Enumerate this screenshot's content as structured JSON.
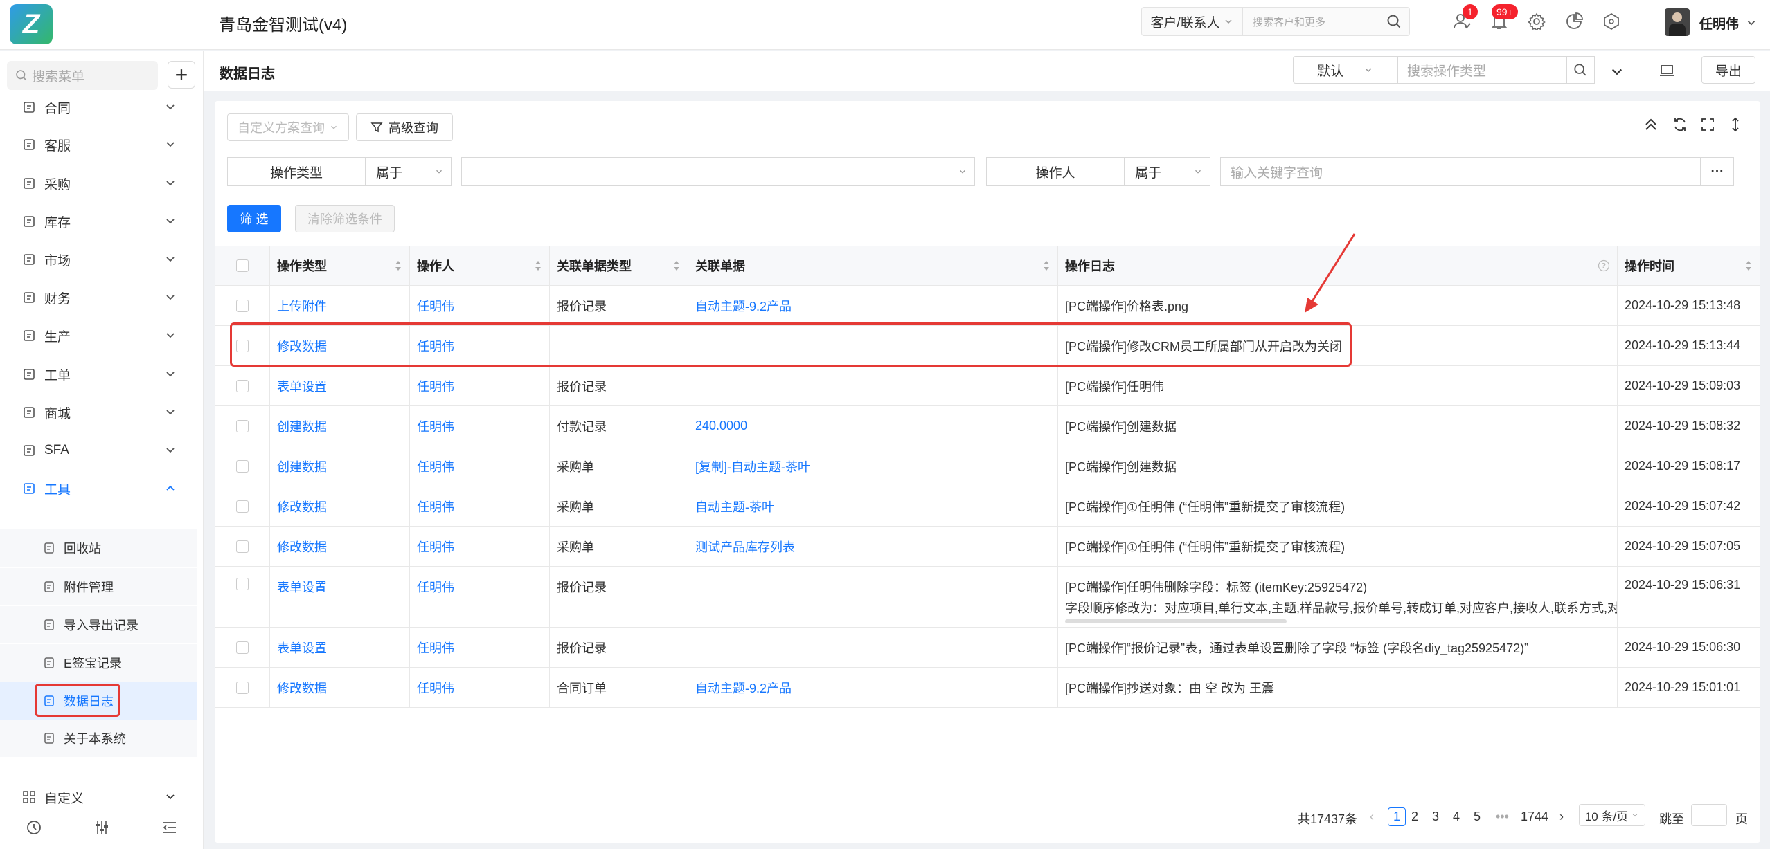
{
  "header": {
    "app_title": "青岛金智测试(v4)",
    "search_scope": "客户/联系人",
    "search_placeholder": "搜索客户和更多",
    "badge_1": "1",
    "badge_2": "99+",
    "user_name": "任明伟"
  },
  "sidebar": {
    "search_placeholder": "搜索菜单",
    "add_label": "+",
    "items": [
      {
        "label": "合同",
        "icon": "contract-icon"
      },
      {
        "label": "客服",
        "icon": "service-icon"
      },
      {
        "label": "采购",
        "icon": "purchase-icon"
      },
      {
        "label": "库存",
        "icon": "warehouse-icon"
      },
      {
        "label": "市场",
        "icon": "market-icon"
      },
      {
        "label": "财务",
        "icon": "finance-icon"
      },
      {
        "label": "生产",
        "icon": "production-icon"
      },
      {
        "label": "工单",
        "icon": "workorder-icon"
      },
      {
        "label": "商城",
        "icon": "mall-icon"
      },
      {
        "label": "SFA",
        "icon": "sfa-icon"
      },
      {
        "label": "工具",
        "icon": "tools-icon"
      }
    ],
    "sub_items": [
      {
        "label": "回收站",
        "icon": "trash-icon"
      },
      {
        "label": "附件管理",
        "icon": "attachment-icon"
      },
      {
        "label": "导入导出记录",
        "icon": "import-export-icon"
      },
      {
        "label": "E签宝记录",
        "icon": "esign-icon"
      },
      {
        "label": "数据日志",
        "icon": "log-icon"
      },
      {
        "label": "关于本系统",
        "icon": "info-icon"
      }
    ],
    "custom_label": "自定义"
  },
  "page": {
    "title": "数据日志",
    "sort_value": "默认",
    "op_type_placeholder": "搜索操作类型",
    "export_label": "导出"
  },
  "toolbar": {
    "scheme_placeholder": "自定义方案查询",
    "advanced_label": "高级查询",
    "filter1_field": "操作类型",
    "filter1_op": "属于",
    "filter2_field": "操作人",
    "filter2_op": "属于",
    "keyword_placeholder": "输入关键字查询",
    "more_label": "···",
    "apply_label": "筛 选",
    "clear_label": "清除筛选条件"
  },
  "table": {
    "columns": [
      "操作类型",
      "操作人",
      "关联单据类型",
      "关联单据",
      "操作日志",
      "操作时间"
    ],
    "rows": [
      {
        "type": "上传附件",
        "user": "任明伟",
        "doc_type": "报价记录",
        "doc": "自动主题-9.2产品",
        "log": "[PC端操作]价格表.png",
        "log2": "",
        "time": "2024-10-29 15:13:48"
      },
      {
        "type": "修改数据",
        "user": "任明伟",
        "doc_type": "",
        "doc": "",
        "log": "[PC端操作]修改CRM员工所属部门从开启改为关闭",
        "log2": "",
        "time": "2024-10-29 15:13:44"
      },
      {
        "type": "表单设置",
        "user": "任明伟",
        "doc_type": "报价记录",
        "doc": "",
        "log": "[PC端操作]任明伟",
        "log2": "",
        "time": "2024-10-29 15:09:03"
      },
      {
        "type": "创建数据",
        "user": "任明伟",
        "doc_type": "付款记录",
        "doc": "240.0000",
        "log": "[PC端操作]创建数据",
        "log2": "",
        "time": "2024-10-29 15:08:32"
      },
      {
        "type": "创建数据",
        "user": "任明伟",
        "doc_type": "采购单",
        "doc": "[复制]-自动主题-茶叶",
        "log": "[PC端操作]创建数据",
        "log2": "",
        "time": "2024-10-29 15:08:17"
      },
      {
        "type": "修改数据",
        "user": "任明伟",
        "doc_type": "采购单",
        "doc": "自动主题-茶叶",
        "log": "[PC端操作]①任明伟 (“任明伟”重新提交了审核流程)",
        "log2": "",
        "time": "2024-10-29 15:07:42"
      },
      {
        "type": "修改数据",
        "user": "任明伟",
        "doc_type": "采购单",
        "doc": "测试产品库存列表",
        "log": "[PC端操作]①任明伟 (“任明伟”重新提交了审核流程)",
        "log2": "",
        "time": "2024-10-29 15:07:05"
      },
      {
        "type": "表单设置",
        "user": "任明伟",
        "doc_type": "报价记录",
        "doc": "",
        "log": "[PC端操作]任明伟删除字段：标签 (itemKey:25925472)",
        "log2": "字段顺序修改为：对应项目,单行文本,主题,样品款号,报价单号,转成订单,对应客户,接收人,联系方式,对应",
        "time": "2024-10-29 15:06:31"
      },
      {
        "type": "表单设置",
        "user": "任明伟",
        "doc_type": "报价记录",
        "doc": "",
        "log": "[PC端操作]“报价记录”表，通过表单设置删除了字段 “标签 (字段名diy_tag25925472)”",
        "log2": "",
        "time": "2024-10-29 15:06:30"
      },
      {
        "type": "修改数据",
        "user": "任明伟",
        "doc_type": "合同订单",
        "doc": "自动主题-9.2产品",
        "log": "[PC端操作]抄送对象：由 空 改为 王震",
        "log2": "",
        "time": "2024-10-29 15:01:01"
      }
    ]
  },
  "pagination": {
    "total": "共17437条",
    "pages": [
      "1",
      "2",
      "3",
      "4",
      "5"
    ],
    "ellipsis": "•••",
    "last": "1744",
    "page_size": "10 条/页",
    "jump_label": "跳至",
    "page_suffix": "页"
  },
  "colors": {
    "primary": "#1677ff",
    "annotation_red": "#e53935"
  }
}
